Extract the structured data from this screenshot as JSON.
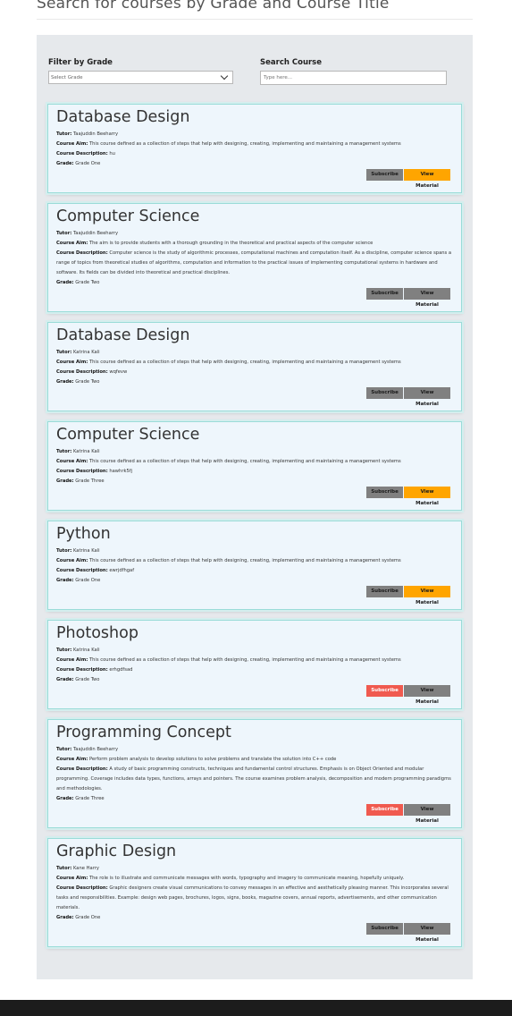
{
  "page": {
    "heading": "Search for courses by Grade and Course Title"
  },
  "filters": {
    "grade_label": "Filter by Grade",
    "grade_selected": "Select Grade",
    "search_label": "Search Course",
    "search_placeholder": "Type here..."
  },
  "field_labels": {
    "tutor": "Tutor:",
    "aim": "Course Aim:",
    "description": "Course Description:",
    "grade": "Grade:"
  },
  "colors": {
    "gray_button": "#808080",
    "orange_button": "#ffa500",
    "red_button": "#f05a4f"
  },
  "courses": [
    {
      "title": "Database Design",
      "tutor": "Taajuddin Beeharry",
      "aim": "This course defined as a collection of steps that help with designing, creating, implementing and maintaining a management systems",
      "description": "hu",
      "grade": "Grade One",
      "subscribe_label": "Subscribe",
      "view_label": "View Material",
      "subscribe_color": "#808080",
      "view_color": "#ffa500"
    },
    {
      "title": "Computer Science",
      "tutor": "Taajuddin Beeharry",
      "aim": "The aim is to provide students with a thorough grounding in the theoretical and practical aspects of the computer science",
      "description": "Computer science is the study of algorithmic processes, computational machines and computation itself. As a discipline, computer science spans a range of topics from theoretical studies of algorithms, computation and information to the practical issues of implementing computational systems in hardware and software. Its fields can be divided into theoretical and practical disciplines.",
      "grade": "Grade Two",
      "subscribe_label": "Subscribe",
      "view_label": "View Material",
      "subscribe_color": "#808080",
      "view_color": "#808080"
    },
    {
      "title": "Database Design",
      "tutor": "Katrina Kali",
      "aim": "This course defined as a collection of steps that help with designing, creating, implementing and maintaining a management systems",
      "description": "wqfevw",
      "grade": "Grade Two",
      "subscribe_label": "Subscribe",
      "view_label": "View Material",
      "subscribe_color": "#808080",
      "view_color": "#808080"
    },
    {
      "title": "Computer Science",
      "tutor": "Katrina Kali",
      "aim": "This course defined as a collection of steps that help with designing, creating, implementing and maintaining a management systems",
      "description": "hawhrk5fj",
      "grade": "Grade Three",
      "subscribe_label": "Subscribe",
      "view_label": "View Material",
      "subscribe_color": "#808080",
      "view_color": "#ffa500"
    },
    {
      "title": "Python",
      "tutor": "Katrina Kali",
      "aim": "This course defined as a collection of steps that help with designing, creating, implementing and maintaining a management systems",
      "description": "ewrjdfhgaf",
      "grade": "Grade One",
      "subscribe_label": "Subscribe",
      "view_label": "View Material",
      "subscribe_color": "#808080",
      "view_color": "#ffa500"
    },
    {
      "title": "Photoshop",
      "tutor": "Katrina Kali",
      "aim": "This course defined as a collection of steps that help with designing, creating, implementing and maintaining a management systems",
      "description": "erhgdfsad",
      "grade": "Grade Two",
      "subscribe_label": "Subscribe",
      "view_label": "View Material",
      "subscribe_color": "#f05a4f",
      "view_color": "#808080"
    },
    {
      "title": "Programming Concept",
      "tutor": "Taajuddin Beeharry",
      "aim": "Perform problem analysis to develop solutions to solve problems and translate the solution into C++ code",
      "description": "A study of basic programming constructs, techniques and fundamental control structures. Emphasis is on Object Oriented and modular programming. Coverage includes data types, functions, arrays and pointers. The course examines problem analysis, decomposition and modern programming paradigms and methodologies.",
      "grade": "Grade Three",
      "subscribe_label": "Subscribe",
      "view_label": "View Material",
      "subscribe_color": "#f05a4f",
      "view_color": "#808080"
    },
    {
      "title": "Graphic Design",
      "tutor": "Kane Harry",
      "aim": "The role is to illustrate and communicate messages with words, typography and imagery to communicate meaning, hopefully uniquely.",
      "description": "Graphic designers create visual communications to convey messages in an effective and aesthetically pleasing manner. This incorporates several tasks and responsibilities. Example: design web pages, brochures, logos, signs, books, magazine covers, annual reports, advertisements, and other communication materials.",
      "grade": "Grade One",
      "subscribe_label": "Subscribe",
      "view_label": "View Material",
      "subscribe_color": "#808080",
      "view_color": "#808080"
    }
  ]
}
